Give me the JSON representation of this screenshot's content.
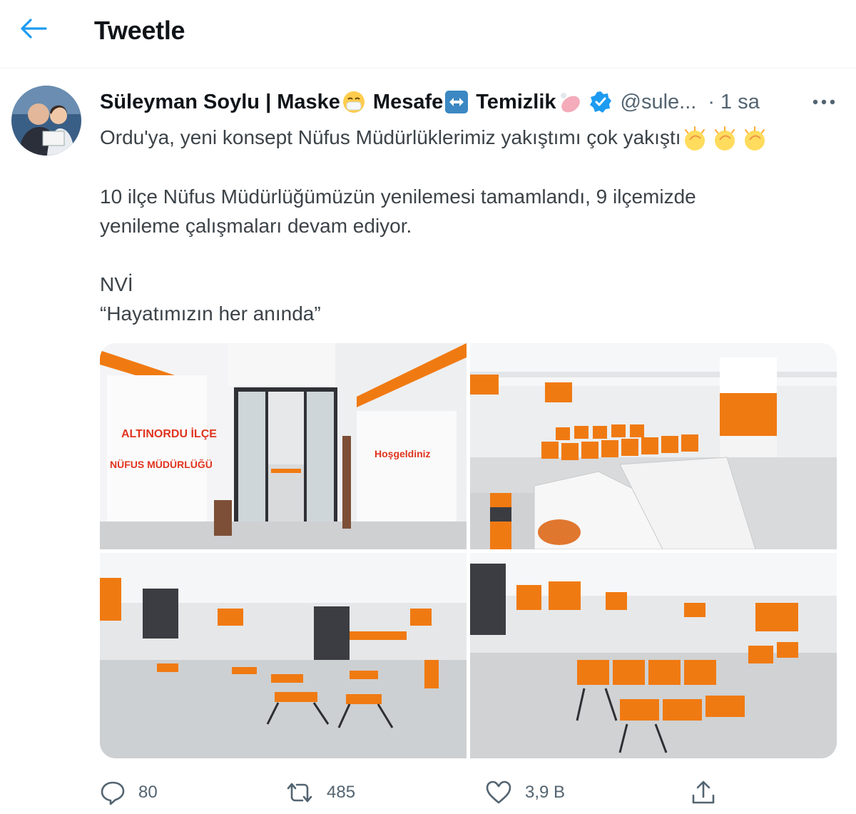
{
  "header": {
    "title": "Tweetle",
    "back_icon": "arrow-left-icon",
    "accent": "#1d9bf0"
  },
  "author": {
    "name_part1": "Süleyman Soylu | Maske",
    "name_part2": "Mesafe",
    "name_part3": "Temizlik",
    "handle": "@sule...",
    "time": "· 1 sa",
    "verified_color": "#1d9bf0"
  },
  "tweet": {
    "line1": "Ordu'ya, yeni konsept Nüfus Müdürlüklerimiz yakıştımı çok yakıştı",
    "line2": "10 ilçe Nüfus Müdürlüğümüzün yenilemesi tamamlandı, 9 ilçemizde",
    "line3": "yenileme çalışmaları devam ediyor.",
    "line4": "NVİ",
    "line5": "“Hayatımızın her anında”"
  },
  "photo_text": {
    "wall_line1": "ALTINORDU İLÇE",
    "wall_line2": "NÜFUS MÜDÜRLÜĞÜ",
    "wall_right": "Hoşgeldiniz"
  },
  "actions": {
    "replies": "80",
    "retweets": "485",
    "likes": "3,9 B"
  },
  "colors": {
    "orange": "#f07a12",
    "text_secondary": "#536471"
  }
}
